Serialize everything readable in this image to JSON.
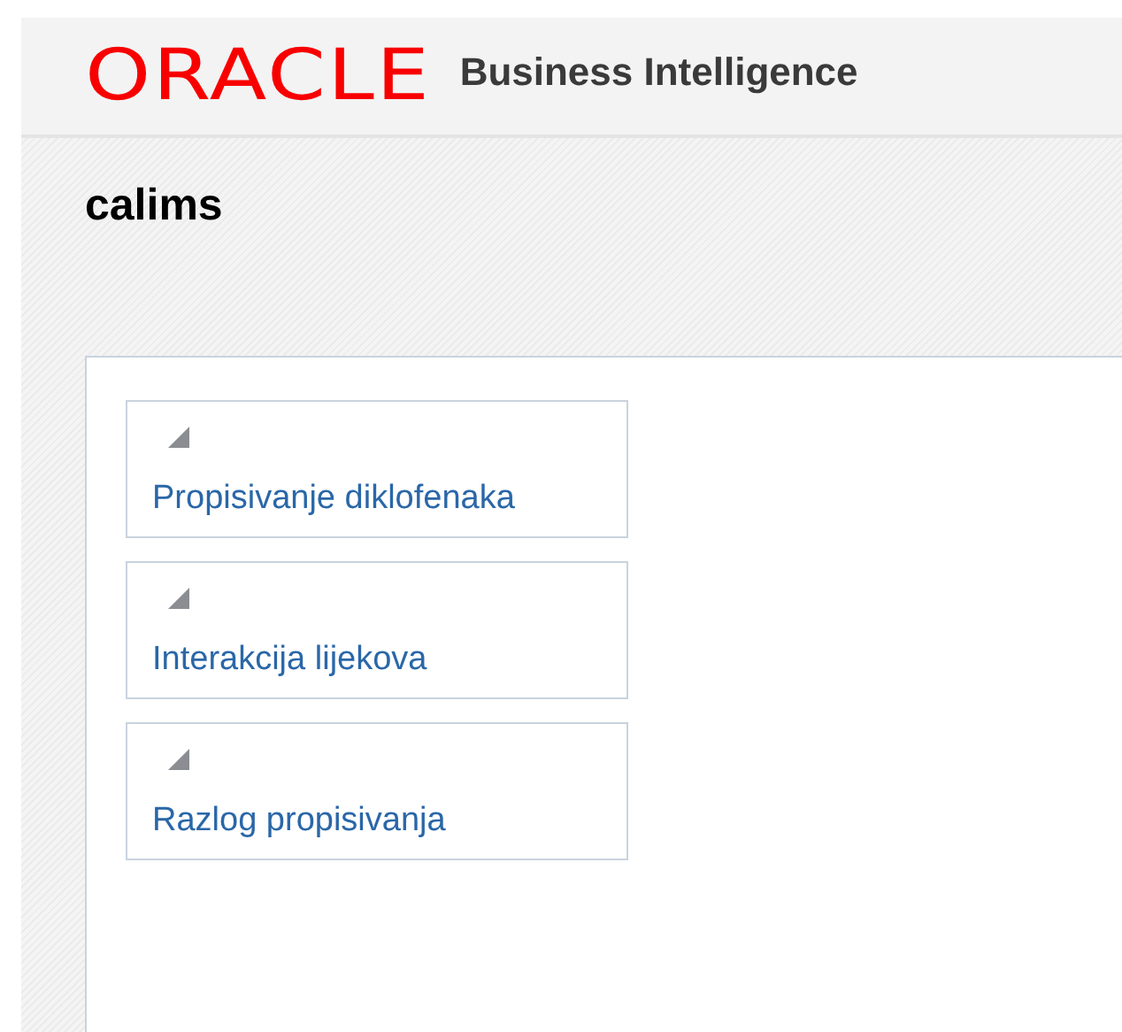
{
  "header": {
    "logo": "ORACLE",
    "product": "Business Intelligence"
  },
  "page_title": "calims",
  "sections": [
    {
      "title": "Propisivanje diklofenaka",
      "expanded": true
    },
    {
      "title": "Interakcija lijekova",
      "expanded": true
    },
    {
      "title": "Razlog propisivanja",
      "expanded": true
    }
  ]
}
